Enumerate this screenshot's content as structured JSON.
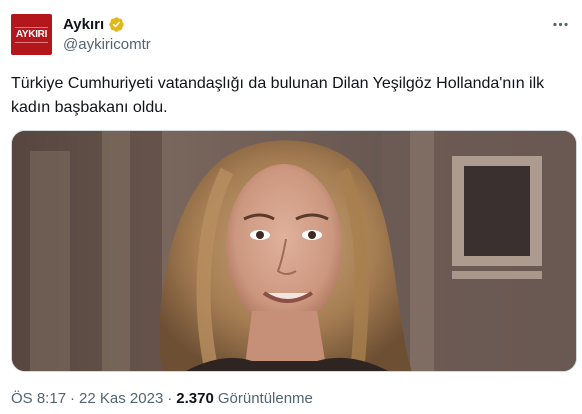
{
  "author": {
    "display_name": "Aykırı",
    "handle": "@aykiricomtr",
    "avatar_text": "AYKIRI",
    "verified_badge_color": "#e2b719",
    "icons": {
      "verified": "verified-gold-badge-icon",
      "more": "more-options-icon"
    }
  },
  "tweet": {
    "text": "Türkiye Cumhuriyeti vatandaşlığı da bulunan Dilan Yeşilgöz Hollanda'nın ilk kadın başbakanı oldu.",
    "image": {
      "subject": "portrait-photo"
    }
  },
  "meta": {
    "time": "ÖS 8:17",
    "separator": "·",
    "date": "22 Kas 2023",
    "views_count": "2.370",
    "views_label": "Görüntülenme"
  },
  "colors": {
    "text_primary": "#0f1419",
    "text_secondary": "#536471",
    "brand_red": "#b3161b"
  }
}
